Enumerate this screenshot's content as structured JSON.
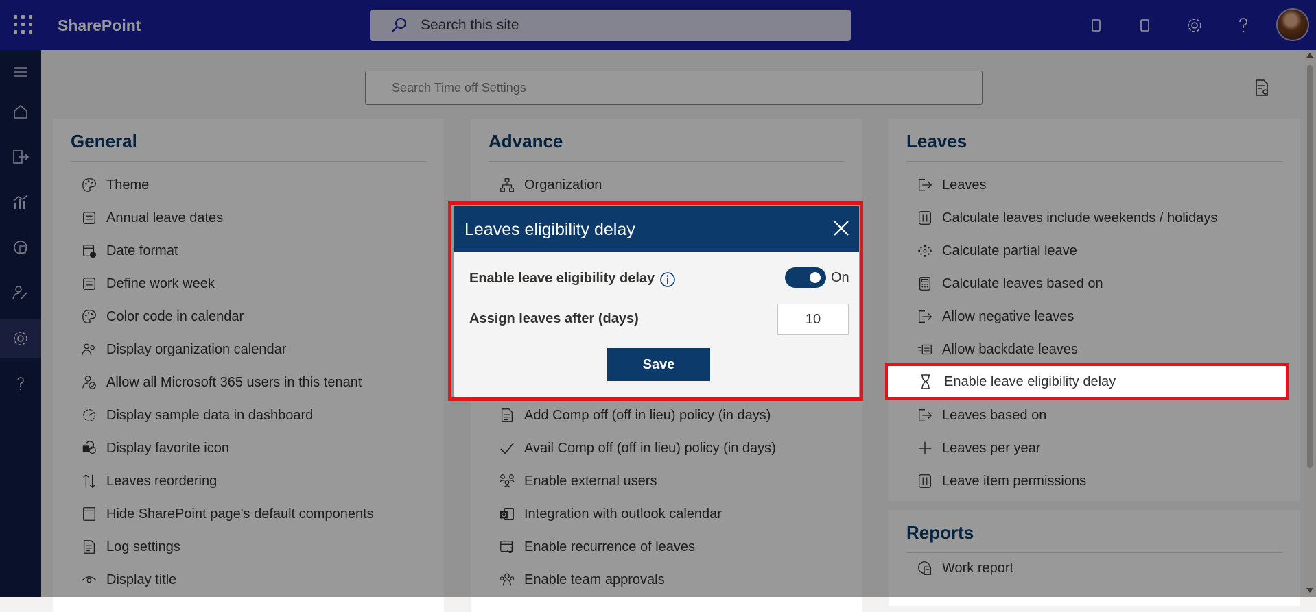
{
  "header": {
    "app_name": "SharePoint",
    "search_placeholder": "Search this site"
  },
  "settings_search_placeholder": "Search Time off Settings",
  "panels": {
    "general": {
      "title": "General",
      "items": [
        {
          "label": "Theme",
          "icon": "palette-icon"
        },
        {
          "label": "Annual leave dates",
          "icon": "calendar-box-icon"
        },
        {
          "label": "Date format",
          "icon": "calendar-clock-icon"
        },
        {
          "label": "Define work week",
          "icon": "calendar-box-icon"
        },
        {
          "label": "Color code in calendar",
          "icon": "palette-icon"
        },
        {
          "label": "Display organization calendar",
          "icon": "people-icon"
        },
        {
          "label": "Allow all Microsoft 365 users in this tenant",
          "icon": "person-check-icon"
        },
        {
          "label": "Display sample data in dashboard",
          "icon": "gauge-icon"
        },
        {
          "label": "Display favorite icon",
          "icon": "sharepoint-icon"
        },
        {
          "label": "Leaves reordering",
          "icon": "sort-arrows-icon"
        },
        {
          "label": "Hide SharePoint page's default components",
          "icon": "page-icon"
        },
        {
          "label": "Log settings",
          "icon": "log-icon"
        },
        {
          "label": "Display title",
          "icon": "eye-icon"
        }
      ]
    },
    "advance": {
      "title": "Advance",
      "items_top": [
        {
          "label": "Organization",
          "icon": "org-chart-icon"
        }
      ],
      "items_bottom": [
        {
          "label": "Add Comp off (off in lieu) policy (in days)",
          "icon": "document-icon"
        },
        {
          "label": "Avail Comp off (off in lieu) policy (in days)",
          "icon": "checkmark-icon"
        },
        {
          "label": "Enable external users",
          "icon": "people-network-icon"
        },
        {
          "label": "Integration with outlook calendar",
          "icon": "outlook-icon"
        },
        {
          "label": "Enable recurrence of leaves",
          "icon": "calendar-repeat-icon"
        },
        {
          "label": "Enable team approvals",
          "icon": "team-icon"
        }
      ]
    },
    "leaves": {
      "title": "Leaves",
      "items": [
        {
          "label": "Leaves",
          "icon": "sign-out-icon"
        },
        {
          "label": "Calculate leaves include weekends / holidays",
          "icon": "columns-icon"
        },
        {
          "label": "Calculate partial leave",
          "icon": "dots-circle-icon"
        },
        {
          "label": "Calculate leaves based on",
          "icon": "calculator-icon"
        },
        {
          "label": "Allow negative leaves",
          "icon": "sign-out-icon"
        },
        {
          "label": "Allow backdate leaves",
          "icon": "backdate-icon"
        },
        {
          "label": "Enable leave eligibility delay",
          "icon": "hourglass-icon"
        },
        {
          "label": "Leaves based on",
          "icon": "sign-out-icon"
        },
        {
          "label": "Leaves per year",
          "icon": "plus-icon"
        },
        {
          "label": "Leave item permissions",
          "icon": "columns-icon"
        }
      ]
    },
    "reports": {
      "title": "Reports",
      "items": [
        {
          "label": "Work report",
          "icon": "report-icon"
        }
      ]
    }
  },
  "dialog": {
    "title": "Leaves eligibility delay",
    "enable_label": "Enable leave eligibility delay",
    "toggle_state": "On",
    "toggle_on": true,
    "days_label": "Assign leaves after (days)",
    "days_value": "10",
    "save_label": "Save"
  },
  "colors": {
    "header": "#1a1f9e",
    "rail": "#121d46",
    "accent": "#0c3a6b",
    "highlight": "#e0141c"
  }
}
